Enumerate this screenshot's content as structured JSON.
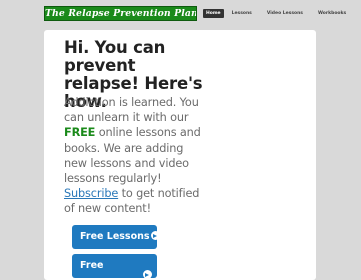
{
  "header": {
    "logo_text": "The Relapse Prevention Plan",
    "nav": [
      {
        "label": "Home",
        "active": true
      },
      {
        "label": "Lessons",
        "active": false
      },
      {
        "label": "Video Lessons",
        "active": false
      },
      {
        "label": "Workbooks",
        "active": false
      }
    ]
  },
  "main": {
    "headline": "Hi. You can prevent relapse! Here's how.",
    "body_part1": "Addiction is learned. You can unlearn it with our ",
    "free_word": "FREE",
    "body_part2": " online lessons and books. We are adding new lessons and video lessons regularly! ",
    "subscribe_link": "Subscribe",
    "body_part3": " to get notified of new content!",
    "buttons": [
      {
        "label": "Free Lessons",
        "icon": "arrow-circle-right-icon"
      },
      {
        "label": "Free",
        "icon": "arrow-circle-right-icon"
      }
    ]
  },
  "colors": {
    "logo_green": "#1a8a1a",
    "button_blue": "#1f7ac0",
    "link_blue": "#2a78b8",
    "background": "#d9d9d9"
  }
}
